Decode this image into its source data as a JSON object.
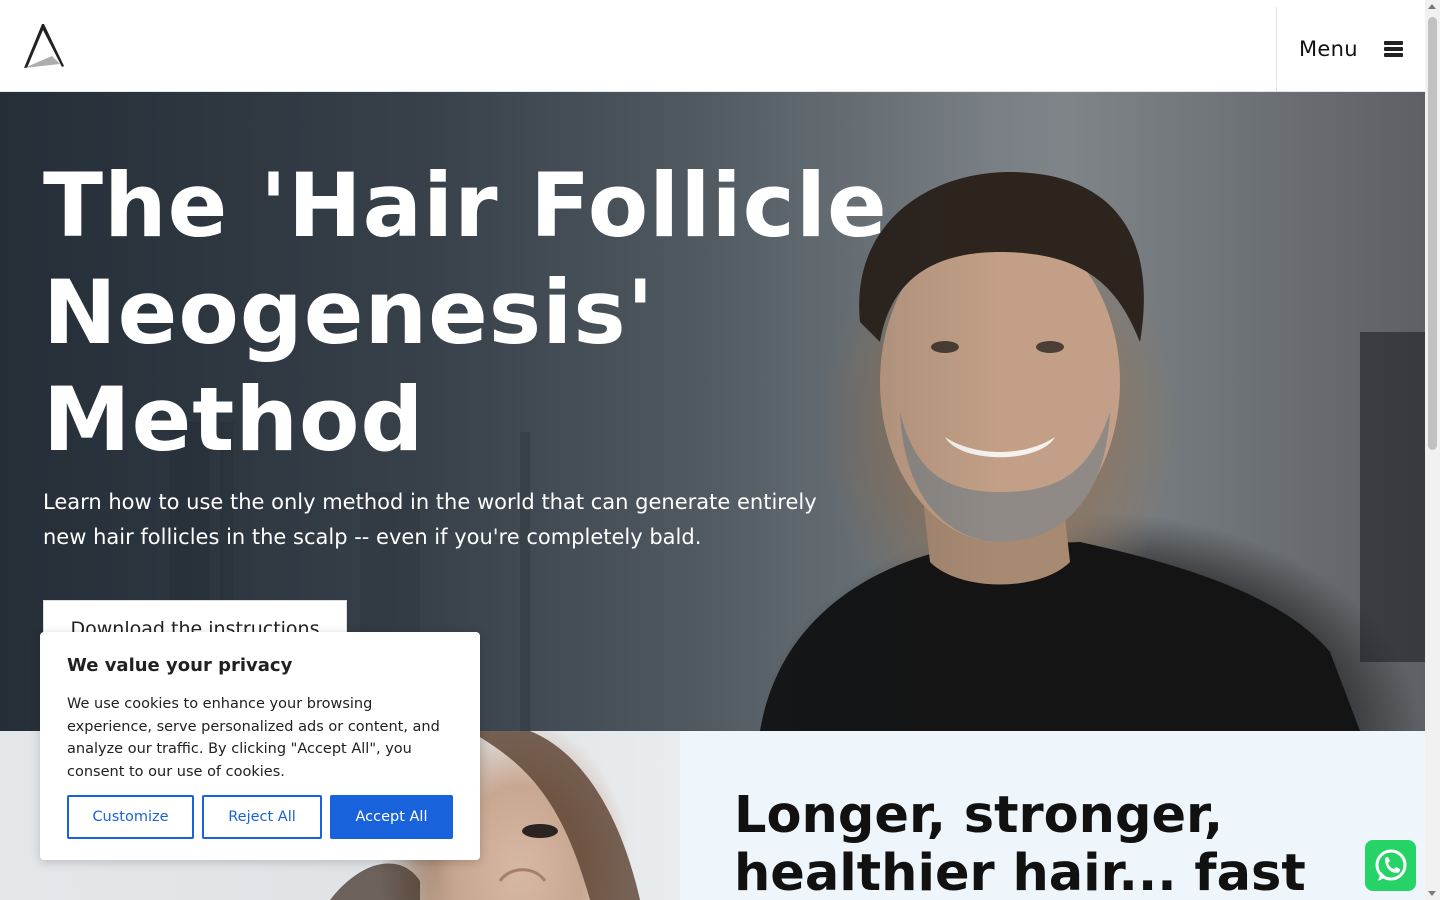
{
  "header": {
    "logo_icon": "a-triangle-logo-icon",
    "menu_label": "Menu",
    "menu_icon": "hamburger-icon"
  },
  "hero": {
    "title": "The 'Hair Follicle Neogenesis' Method",
    "subtitle": "Learn how to use the only method in the world that can generate entirely new hair follicles in the scalp -- even if you're completely bald.",
    "cta_label": "Download the instructions"
  },
  "section2": {
    "title": "Longer, stronger, healthier hair... fast"
  },
  "cookie_banner": {
    "title": "We value your privacy",
    "text": "We use cookies to enhance your browsing experience, serve personalized ads or content, and analyze our traffic. By clicking \"Accept All\", you consent to our use of cookies.",
    "customize_label": "Customize",
    "reject_label": "Reject All",
    "accept_label": "Accept All",
    "accent_color": "#1863dc"
  },
  "whatsapp": {
    "icon": "whatsapp-icon",
    "color": "#25d366"
  }
}
